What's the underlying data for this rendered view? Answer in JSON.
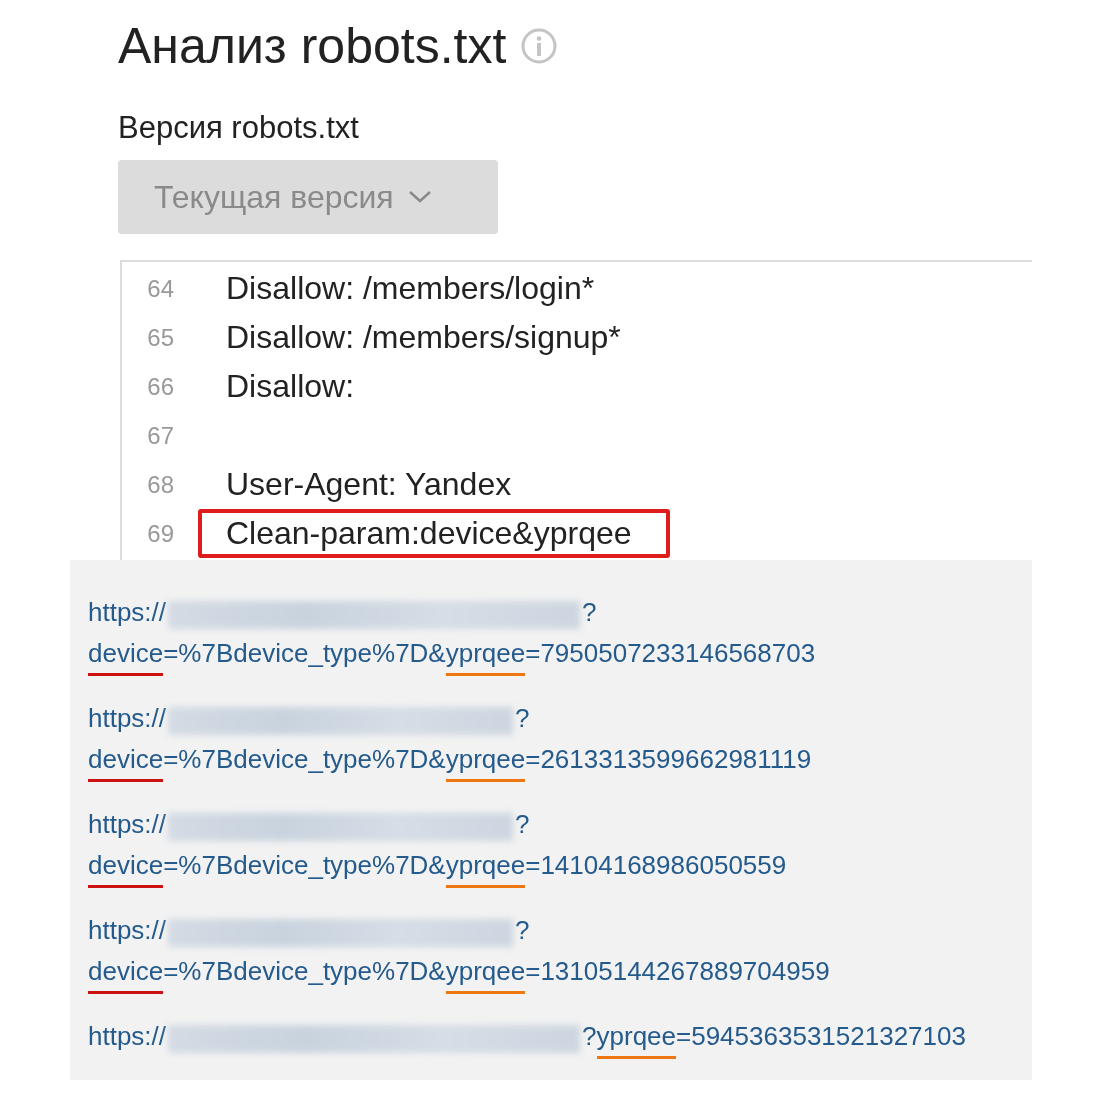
{
  "title": "Анализ robots.txt",
  "version_label": "Версия robots.txt",
  "version_dropdown": {
    "value": "Текущая версия",
    "disabled": true
  },
  "code_lines": [
    {
      "number": "64",
      "text": "Disallow: /members/login*",
      "highlighted": false
    },
    {
      "number": "65",
      "text": "Disallow: /members/signup*",
      "highlighted": false
    },
    {
      "number": "66",
      "text": "Disallow:",
      "highlighted": false
    },
    {
      "number": "67",
      "highlighted": false
    },
    {
      "number": "68",
      "text": "User-Agent: Yandex",
      "highlighted": false
    },
    {
      "number": "69",
      "text": "Clean-param:device&yprqee",
      "highlighted": true
    }
  ],
  "urls": [
    {
      "head": "https://",
      "tail": [
        {
          "text": "?"
        }
      ],
      "query": [
        {
          "text": "device",
          "color": "#cc1111"
        },
        {
          "text": "=%7Bdevice_type%7D&"
        },
        {
          "text": "yprqee",
          "color": "#ee7711"
        },
        {
          "text": "=7950507233146568703"
        }
      ]
    },
    {
      "head": "https://",
      "tail": [
        {
          "text": "?"
        }
      ],
      "query": [
        {
          "text": "device",
          "color": "#cc1111"
        },
        {
          "text": "=%7Bdevice_type%7D&"
        },
        {
          "text": "yprqee",
          "color": "#ee7711"
        },
        {
          "text": "=2613313599662981119"
        }
      ]
    },
    {
      "head": "https://",
      "tail": [
        {
          "text": "?"
        }
      ],
      "query": [
        {
          "text": "device",
          "color": "#cc1111"
        },
        {
          "text": "=%7Bdevice_type%7D&"
        },
        {
          "text": "yprqee",
          "color": "#ee7711"
        },
        {
          "text": "=14104168986050559"
        }
      ]
    },
    {
      "head": "https://",
      "tail": [
        {
          "text": "?"
        }
      ],
      "query": [
        {
          "text": "device",
          "color": "#cc1111"
        },
        {
          "text": "=%7Bdevice_type%7D&"
        },
        {
          "text": "yprqee",
          "color": "#ee7711"
        },
        {
          "text": "=13105144267889704959"
        }
      ]
    },
    {
      "head": "https://",
      "tail": [
        {
          "text": "?"
        },
        {
          "text": "yprqee",
          "color": "#ee7711"
        },
        {
          "text": "=5945363531521327103"
        }
      ]
    }
  ]
}
